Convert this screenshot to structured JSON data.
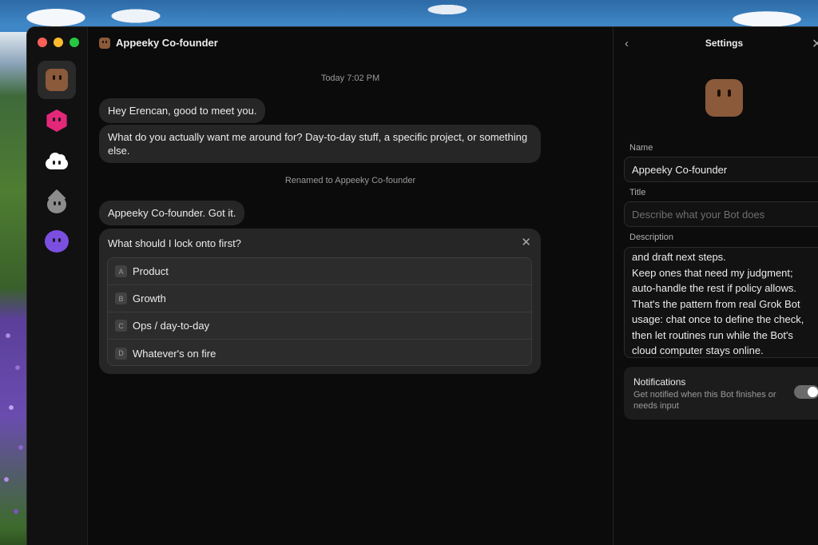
{
  "window": {
    "traffic_lights": [
      "close",
      "minimize",
      "zoom"
    ]
  },
  "rail": {
    "bots": [
      {
        "name": "Appeeky Co-founder",
        "icon": "brown-square-bot-icon",
        "color": "#8a5a3a",
        "active": true
      },
      {
        "icon": "pink-hexagon-bot-icon",
        "color": "#e3287a"
      },
      {
        "icon": "white-cloud-bot-icon",
        "color": "#ffffff"
      },
      {
        "icon": "gray-drop-bot-icon",
        "color": "#8c8c8c"
      },
      {
        "icon": "purple-blob-bot-icon",
        "color": "#7b4fe0"
      }
    ]
  },
  "chat": {
    "title": "Appeeky Co-founder",
    "timestamp": "Today 7:02 PM",
    "messages": [
      {
        "text": "Hey Erencan, good to meet you."
      },
      {
        "text_line1": "What do you actually want me around for? Day-to-day stuff, a specific project, or something",
        "text_line2": "else."
      },
      {
        "text": "Appeeky Co-founder. Got it."
      }
    ],
    "system_note": "Renamed to Appeeky Co-founder",
    "question": {
      "text": "What should I lock onto first?",
      "close_glyph": "✕",
      "options": [
        {
          "letter": "A",
          "label": "Product"
        },
        {
          "letter": "B",
          "label": "Growth"
        },
        {
          "letter": "C",
          "label": "Ops / day-to-day"
        },
        {
          "letter": "D",
          "label": "Whatever's on fire"
        }
      ]
    }
  },
  "settings": {
    "back_glyph": "‹",
    "title": "Settings",
    "close_glyph": "✕",
    "name_label": "Name",
    "name_value": "Appeeky Co-founder",
    "title_label": "Title",
    "title_placeholder": "Describe what your Bot does",
    "description_label": "Description",
    "description_lines": [
      "and draft next steps.",
      "Keep ones that need my judgment;",
      "auto-handle the rest if policy allows.",
      "That's the pattern from real Grok Bot",
      "usage: chat once to define the check,",
      "then let routines run while the Bot's",
      "cloud computer stays online."
    ],
    "notifications": {
      "title": "Notifications",
      "subtitle": "Get notified when this Bot finishes or needs input",
      "enabled": true
    }
  },
  "colors": {
    "window_bg": "#0b0b0b",
    "bubble_bg": "#262626",
    "accent_brown": "#8a5a3a"
  }
}
